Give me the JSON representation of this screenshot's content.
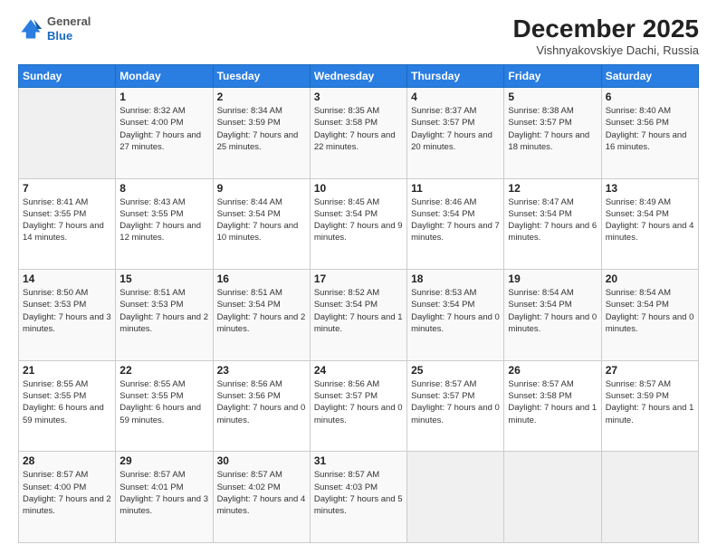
{
  "logo": {
    "general": "General",
    "blue": "Blue"
  },
  "header": {
    "month": "December 2025",
    "location": "Vishnyakovskiye Dachi, Russia"
  },
  "weekdays": [
    "Sunday",
    "Monday",
    "Tuesday",
    "Wednesday",
    "Thursday",
    "Friday",
    "Saturday"
  ],
  "weeks": [
    [
      {
        "day": "",
        "info": ""
      },
      {
        "day": "1",
        "info": "Sunrise: 8:32 AM\nSunset: 4:00 PM\nDaylight: 7 hours\nand 27 minutes."
      },
      {
        "day": "2",
        "info": "Sunrise: 8:34 AM\nSunset: 3:59 PM\nDaylight: 7 hours\nand 25 minutes."
      },
      {
        "day": "3",
        "info": "Sunrise: 8:35 AM\nSunset: 3:58 PM\nDaylight: 7 hours\nand 22 minutes."
      },
      {
        "day": "4",
        "info": "Sunrise: 8:37 AM\nSunset: 3:57 PM\nDaylight: 7 hours\nand 20 minutes."
      },
      {
        "day": "5",
        "info": "Sunrise: 8:38 AM\nSunset: 3:57 PM\nDaylight: 7 hours\nand 18 minutes."
      },
      {
        "day": "6",
        "info": "Sunrise: 8:40 AM\nSunset: 3:56 PM\nDaylight: 7 hours\nand 16 minutes."
      }
    ],
    [
      {
        "day": "7",
        "info": "Sunrise: 8:41 AM\nSunset: 3:55 PM\nDaylight: 7 hours\nand 14 minutes."
      },
      {
        "day": "8",
        "info": "Sunrise: 8:43 AM\nSunset: 3:55 PM\nDaylight: 7 hours\nand 12 minutes."
      },
      {
        "day": "9",
        "info": "Sunrise: 8:44 AM\nSunset: 3:54 PM\nDaylight: 7 hours\nand 10 minutes."
      },
      {
        "day": "10",
        "info": "Sunrise: 8:45 AM\nSunset: 3:54 PM\nDaylight: 7 hours\nand 9 minutes."
      },
      {
        "day": "11",
        "info": "Sunrise: 8:46 AM\nSunset: 3:54 PM\nDaylight: 7 hours\nand 7 minutes."
      },
      {
        "day": "12",
        "info": "Sunrise: 8:47 AM\nSunset: 3:54 PM\nDaylight: 7 hours\nand 6 minutes."
      },
      {
        "day": "13",
        "info": "Sunrise: 8:49 AM\nSunset: 3:54 PM\nDaylight: 7 hours\nand 4 minutes."
      }
    ],
    [
      {
        "day": "14",
        "info": "Sunrise: 8:50 AM\nSunset: 3:53 PM\nDaylight: 7 hours\nand 3 minutes."
      },
      {
        "day": "15",
        "info": "Sunrise: 8:51 AM\nSunset: 3:53 PM\nDaylight: 7 hours\nand 2 minutes."
      },
      {
        "day": "16",
        "info": "Sunrise: 8:51 AM\nSunset: 3:54 PM\nDaylight: 7 hours\nand 2 minutes."
      },
      {
        "day": "17",
        "info": "Sunrise: 8:52 AM\nSunset: 3:54 PM\nDaylight: 7 hours\nand 1 minute."
      },
      {
        "day": "18",
        "info": "Sunrise: 8:53 AM\nSunset: 3:54 PM\nDaylight: 7 hours\nand 0 minutes."
      },
      {
        "day": "19",
        "info": "Sunrise: 8:54 AM\nSunset: 3:54 PM\nDaylight: 7 hours\nand 0 minutes."
      },
      {
        "day": "20",
        "info": "Sunrise: 8:54 AM\nSunset: 3:54 PM\nDaylight: 7 hours\nand 0 minutes."
      }
    ],
    [
      {
        "day": "21",
        "info": "Sunrise: 8:55 AM\nSunset: 3:55 PM\nDaylight: 6 hours\nand 59 minutes."
      },
      {
        "day": "22",
        "info": "Sunrise: 8:55 AM\nSunset: 3:55 PM\nDaylight: 6 hours\nand 59 minutes."
      },
      {
        "day": "23",
        "info": "Sunrise: 8:56 AM\nSunset: 3:56 PM\nDaylight: 7 hours\nand 0 minutes."
      },
      {
        "day": "24",
        "info": "Sunrise: 8:56 AM\nSunset: 3:57 PM\nDaylight: 7 hours\nand 0 minutes."
      },
      {
        "day": "25",
        "info": "Sunrise: 8:57 AM\nSunset: 3:57 PM\nDaylight: 7 hours\nand 0 minutes."
      },
      {
        "day": "26",
        "info": "Sunrise: 8:57 AM\nSunset: 3:58 PM\nDaylight: 7 hours\nand 1 minute."
      },
      {
        "day": "27",
        "info": "Sunrise: 8:57 AM\nSunset: 3:59 PM\nDaylight: 7 hours\nand 1 minute."
      }
    ],
    [
      {
        "day": "28",
        "info": "Sunrise: 8:57 AM\nSunset: 4:00 PM\nDaylight: 7 hours\nand 2 minutes."
      },
      {
        "day": "29",
        "info": "Sunrise: 8:57 AM\nSunset: 4:01 PM\nDaylight: 7 hours\nand 3 minutes."
      },
      {
        "day": "30",
        "info": "Sunrise: 8:57 AM\nSunset: 4:02 PM\nDaylight: 7 hours\nand 4 minutes."
      },
      {
        "day": "31",
        "info": "Sunrise: 8:57 AM\nSunset: 4:03 PM\nDaylight: 7 hours\nand 5 minutes."
      },
      {
        "day": "",
        "info": ""
      },
      {
        "day": "",
        "info": ""
      },
      {
        "day": "",
        "info": ""
      }
    ]
  ]
}
